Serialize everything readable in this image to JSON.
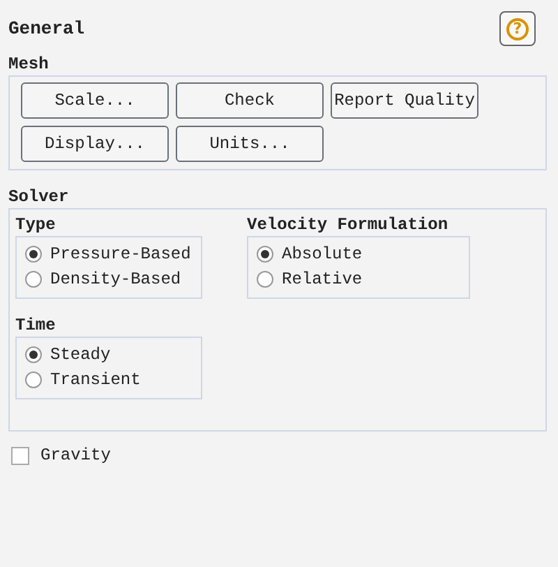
{
  "title": "General",
  "help": {
    "label": "?"
  },
  "mesh": {
    "label": "Mesh",
    "buttons": [
      [
        "Scale...",
        "Check",
        "Report Quality"
      ],
      [
        "Display...",
        "Units..."
      ]
    ]
  },
  "solver": {
    "label": "Solver",
    "groups": [
      {
        "label": "Type",
        "options": [
          {
            "label": "Pressure-Based",
            "selected": true
          },
          {
            "label": "Density-Based",
            "selected": false
          }
        ]
      },
      {
        "label": "Velocity Formulation",
        "options": [
          {
            "label": "Absolute",
            "selected": true
          },
          {
            "label": "Relative",
            "selected": false
          }
        ]
      },
      {
        "label": "Time",
        "options": [
          {
            "label": "Steady",
            "selected": true
          },
          {
            "label": "Transient",
            "selected": false
          }
        ]
      }
    ]
  },
  "gravity": {
    "label": "Gravity",
    "checked": false
  }
}
